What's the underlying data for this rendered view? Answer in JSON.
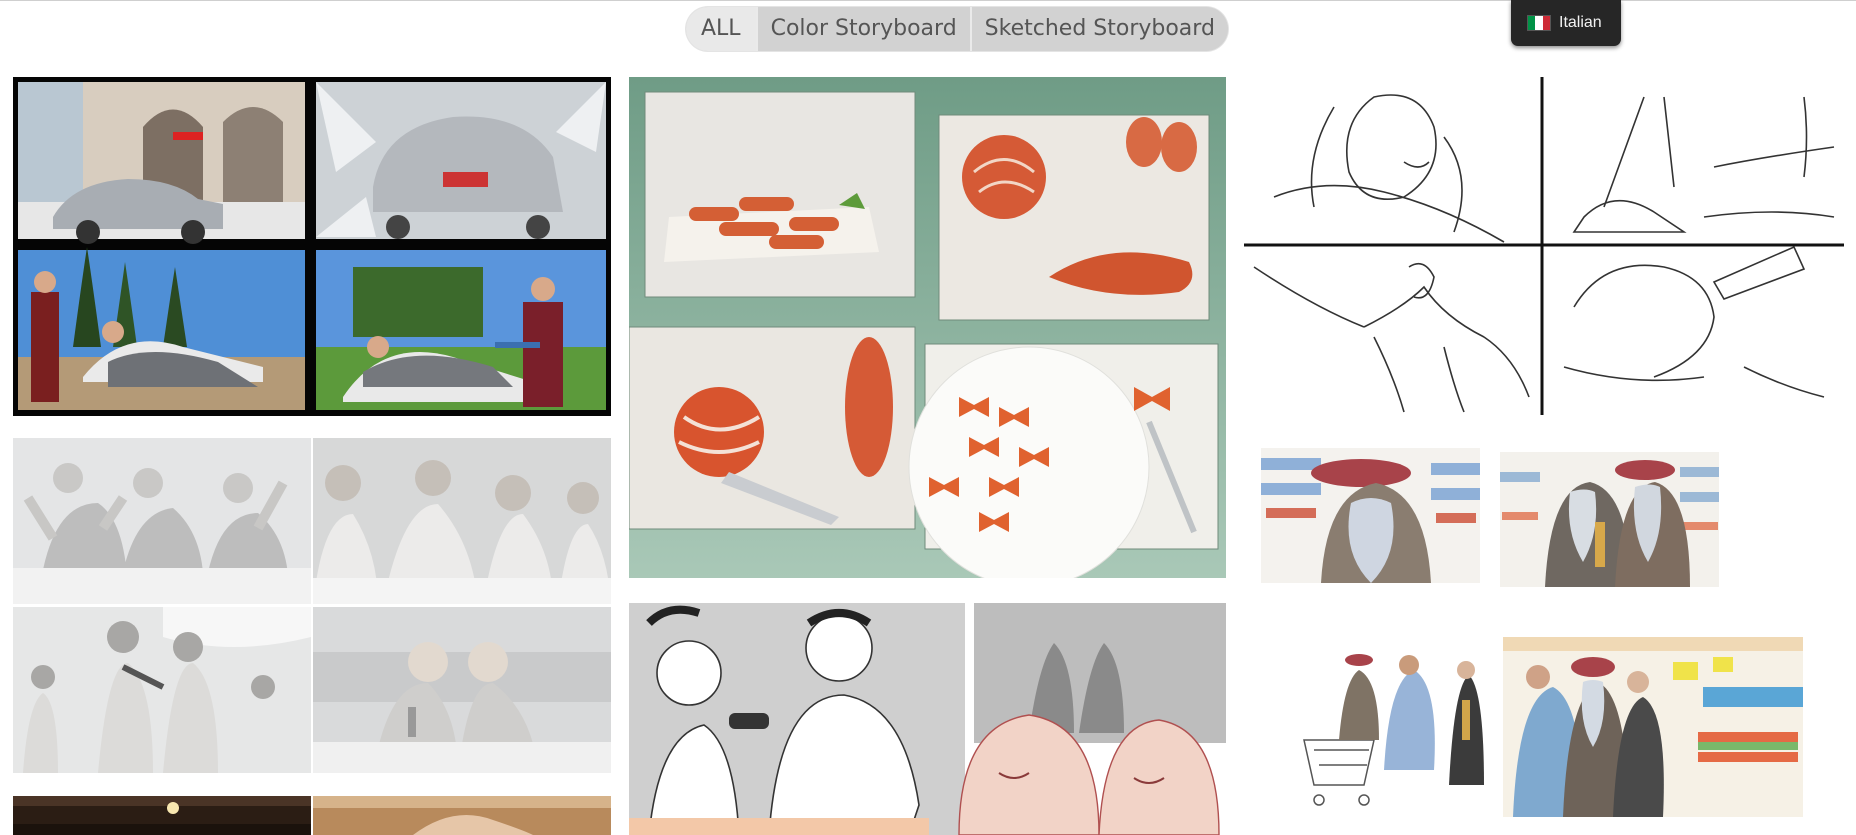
{
  "filters": {
    "all": "ALL",
    "color": "Color Storyboard",
    "sketched": "Sketched Storyboard"
  },
  "language": {
    "label": "Italian",
    "flag_colors": [
      "#009246",
      "#ffffff",
      "#ce2b37"
    ]
  },
  "colors": {
    "pill_bg": "#d2d2d2",
    "pill_active": "#e9e9e9",
    "lang_bg": "#262626",
    "food_bg": "#8fb5a0"
  }
}
